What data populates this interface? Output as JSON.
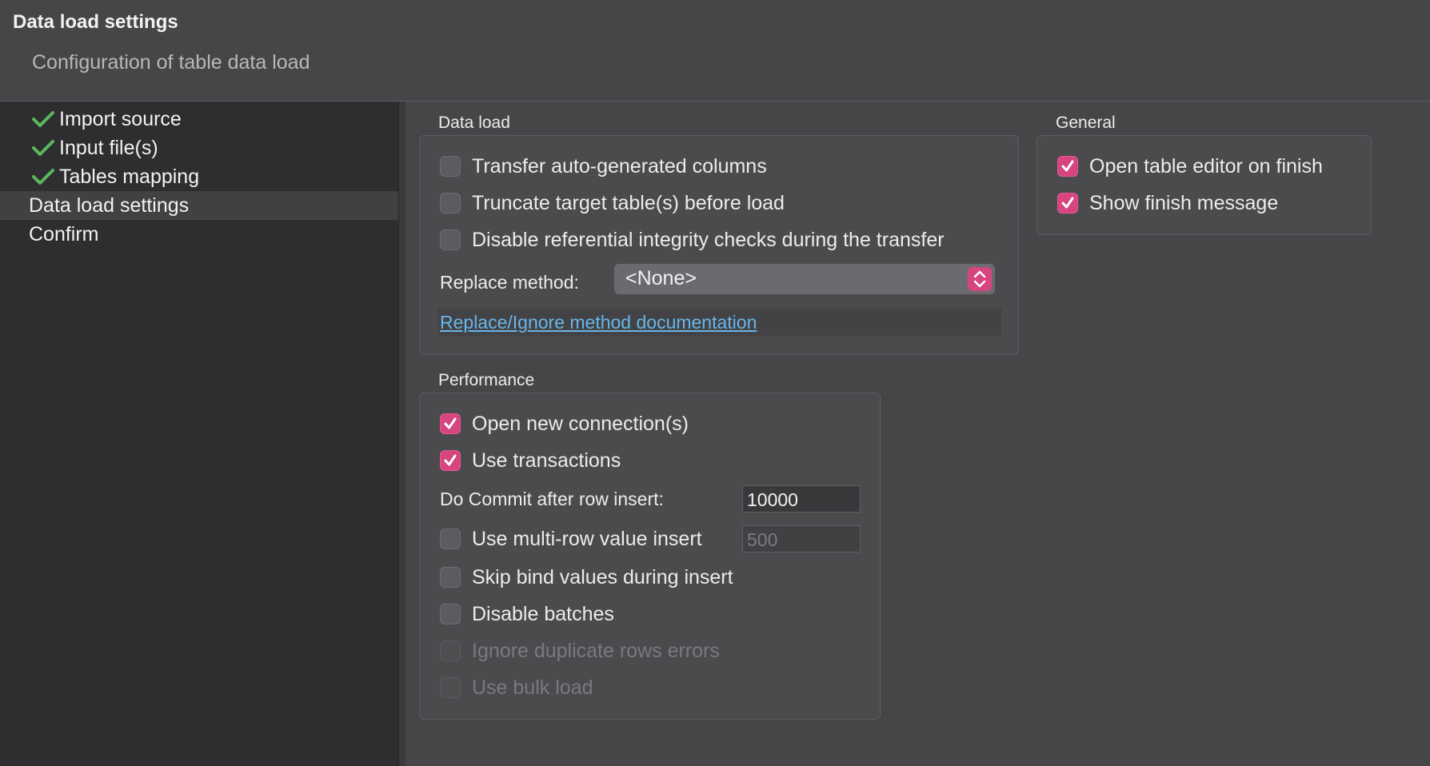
{
  "header": {
    "title": "Data load settings",
    "subtitle": "Configuration of table data load"
  },
  "sidebar": {
    "items": [
      {
        "label": "Import source",
        "completed": true
      },
      {
        "label": "Input file(s)",
        "completed": true
      },
      {
        "label": "Tables mapping",
        "completed": true
      },
      {
        "label": "Data load settings",
        "completed": false,
        "selected": true
      },
      {
        "label": "Confirm",
        "completed": false
      }
    ]
  },
  "data_load": {
    "title": "Data load",
    "options": [
      {
        "label": "Transfer auto-generated columns",
        "checked": false
      },
      {
        "label": "Truncate target table(s) before load",
        "checked": false
      },
      {
        "label": "Disable referential integrity checks during the transfer",
        "checked": false
      }
    ],
    "replace_method_label": "Replace method:",
    "replace_method_value": "<None>",
    "doc_link": "Replace/Ignore method documentation"
  },
  "general": {
    "title": "General",
    "options": [
      {
        "label": "Open table editor on finish",
        "checked": true
      },
      {
        "label": "Show finish message",
        "checked": true
      }
    ]
  },
  "performance": {
    "title": "Performance",
    "open_new_connections": {
      "label": "Open new connection(s)",
      "checked": true
    },
    "use_transactions": {
      "label": "Use transactions",
      "checked": true
    },
    "commit_label": "Do Commit after row insert:",
    "commit_value": "10000",
    "multi_row": {
      "label": "Use multi-row value insert",
      "checked": false
    },
    "multi_row_value": "500",
    "skip_bind": {
      "label": "Skip bind values during insert",
      "checked": false
    },
    "disable_batches": {
      "label": "Disable batches",
      "checked": false
    },
    "ignore_duplicates": {
      "label": "Ignore duplicate rows errors",
      "checked": false,
      "disabled": true
    },
    "bulk_load": {
      "label": "Use bulk load",
      "checked": false,
      "disabled": true
    }
  },
  "colors": {
    "accent": "#d6457f",
    "check_green": "#5cb85c",
    "link": "#67b6ea"
  },
  "icons": {
    "completed": "checkmark-icon",
    "select": "chevron-updown-icon"
  }
}
